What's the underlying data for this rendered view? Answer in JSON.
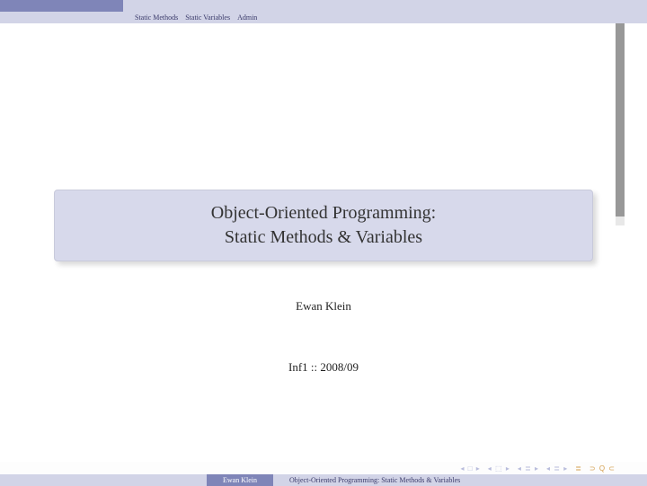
{
  "nav": {
    "item1": "Static Methods",
    "item2": "Static Variables",
    "item3": "Admin"
  },
  "title": {
    "line1": "Object-Oriented Programming:",
    "line2": "Static Methods & Variables"
  },
  "author": "Ewan Klein",
  "course": "Inf1 :: 2008/09",
  "controls": {
    "first": "◂ □ ▸",
    "second": "◂ ⬚ ▸",
    "third": "◂ ≣ ▸",
    "fourth": "◂ ≣ ▸",
    "align": "≣",
    "undo": "⊃ Q ⊂"
  },
  "footer": {
    "author": "Ewan Klein",
    "title": "Object-Oriented Programming: Static Methods & Variables"
  }
}
